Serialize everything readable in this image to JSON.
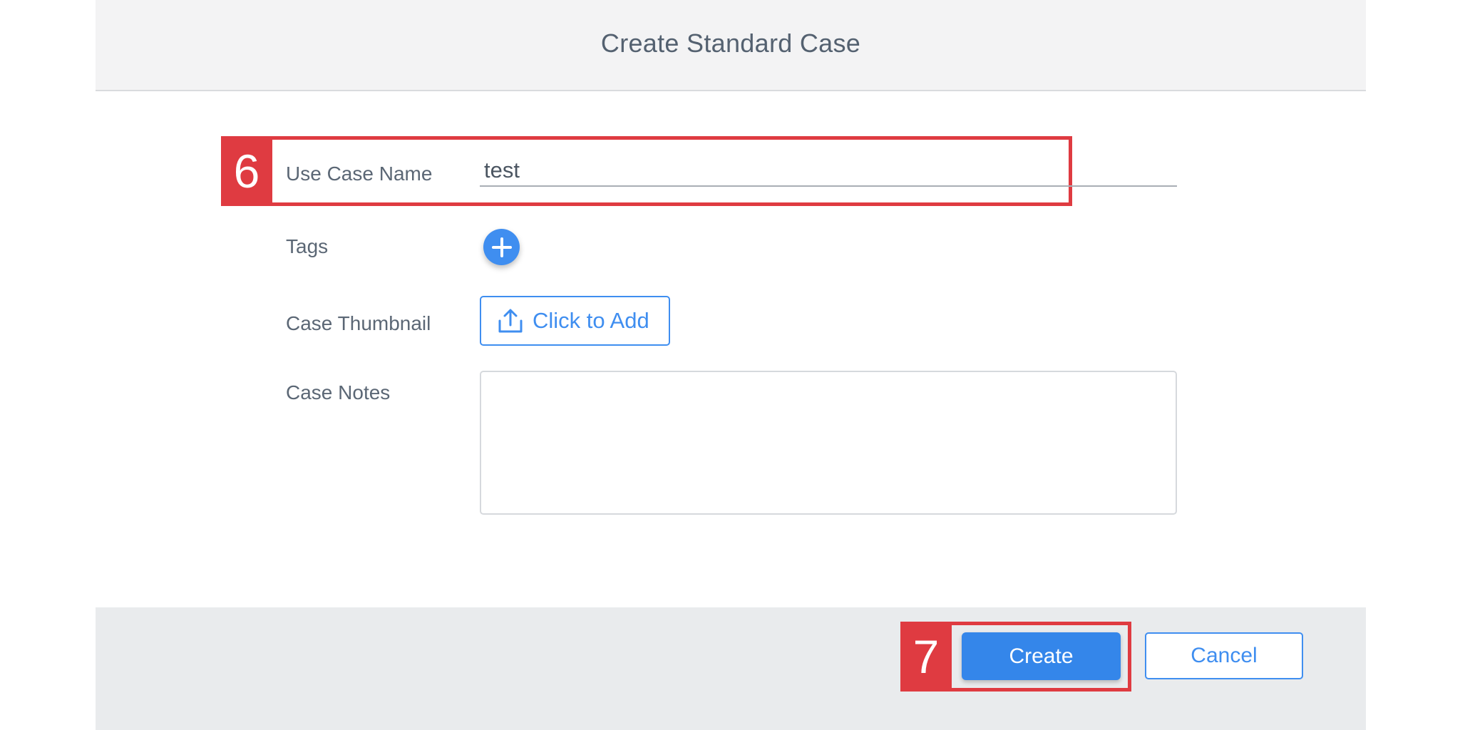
{
  "dialog": {
    "title": "Create Standard Case"
  },
  "form": {
    "name_label": "Use Case Name",
    "name_value": "test",
    "tags_label": "Tags",
    "thumbnail_label": "Case Thumbnail",
    "thumbnail_button_label": "Click to Add",
    "notes_label": "Case Notes",
    "notes_value": ""
  },
  "footer": {
    "create_label": "Create",
    "cancel_label": "Cancel"
  },
  "annotations": {
    "step_name": "6",
    "step_create": "7"
  },
  "icons": {
    "add_tag": "plus-icon",
    "upload": "upload-icon"
  },
  "colors": {
    "accent": "#3f8ef0",
    "annotation": "#df3b41",
    "header_bg": "#f3f3f4",
    "footer_bg": "#e9ebed"
  }
}
